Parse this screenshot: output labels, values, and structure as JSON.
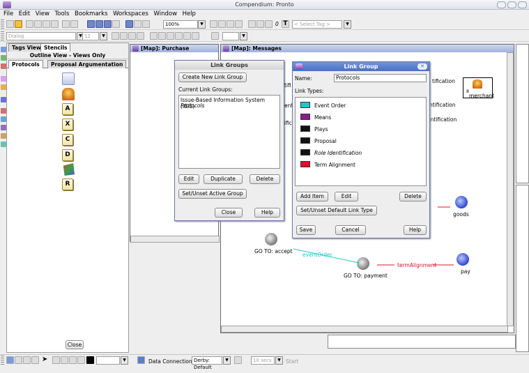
{
  "app": {
    "title": "Compendium: Pronto"
  },
  "menu": [
    "File",
    "Edit",
    "View",
    "Tools",
    "Bookmarks",
    "Workspaces",
    "Window",
    "Help"
  ],
  "toolbar": {
    "zoom": "100%",
    "tag_select": "< Select Tag >",
    "font_name": "Dialog",
    "font_size": "12",
    "italic_marker": "0",
    "text_marker": "T"
  },
  "left_panel": {
    "tabs": [
      "Tags View",
      "Stencils"
    ],
    "subtitle": "Outline View - Views Only",
    "subtabs": [
      "Protocols",
      "Proposal Argumentation"
    ],
    "stencil_letters": [
      "A",
      "X",
      "C",
      "D",
      "R"
    ],
    "close_label": "Close"
  },
  "map_purchase": {
    "title": "[Map]: Purchase"
  },
  "map_messages": {
    "title": "[Map]: Messages"
  },
  "link_groups": {
    "title": "Link Groups",
    "create_label": "Create New Link Group",
    "current_label": "Current Link Groups:",
    "groups": [
      "Issue-Based Information System (IBIS)",
      "Protocols"
    ],
    "buttons": {
      "edit": "Edit",
      "duplicate": "Duplicate",
      "delete": "Delete",
      "set_active": "Set/Unset Active Group",
      "close": "Close",
      "help": "Help"
    }
  },
  "link_group": {
    "title": "Link Group",
    "name_label": "Name:",
    "name_value": "Protocols",
    "types_label": "Link Types:",
    "types": [
      {
        "label": "Event Order",
        "color": "#1ec8c8",
        "italic": false
      },
      {
        "label": "Means",
        "color": "#8a1d8f",
        "italic": false
      },
      {
        "label": "Plays",
        "color": "#111111",
        "italic": false
      },
      {
        "label": "Proposal",
        "color": "#111111",
        "italic": false
      },
      {
        "label": "Role Identification",
        "color": "#111111",
        "italic": true
      },
      {
        "label": "Term Alignment",
        "color": "#e0102a",
        "italic": false
      }
    ],
    "buttons": {
      "add": "Add Item",
      "edit": "Edit",
      "delete": "Delete",
      "set_default": "Set/Unset Default Link Type",
      "save": "Save",
      "cancel": "Cancel",
      "help": "Help"
    }
  },
  "map_nodes": {
    "merchant": "merchant",
    "goods": "goods",
    "accept": "GO TO: accept",
    "payment": "GO TO: payment",
    "pay": "pay",
    "event_order_link": "eventOrder",
    "term_alignment_link": "termAlignment",
    "ification_1": "tification",
    "ification_2": "ntification",
    "ification_3": "entification",
    "badge": "8"
  },
  "partial_labels": {
    "a": "tifi",
    "b": "ent",
    "c": "ific"
  },
  "status": {
    "data_connection_label": "Data Connection:",
    "data_connection_value": "Derby: Default",
    "secs": "10 secs",
    "start": "Start"
  },
  "colors": {
    "title_blue": "#4a6fc4",
    "event_order": "#1ec8c8",
    "term_alignment": "#e0102a"
  }
}
